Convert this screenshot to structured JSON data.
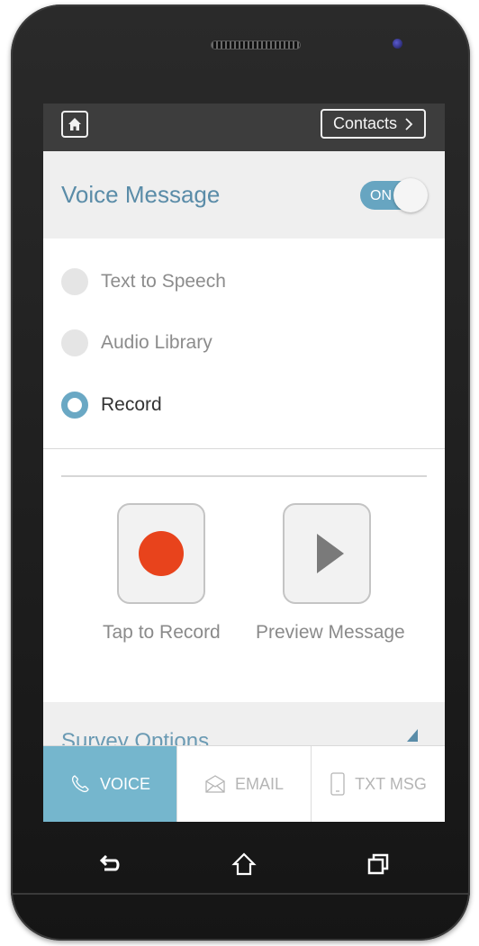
{
  "topbar": {
    "home_icon": "home-icon",
    "contacts_label": "Contacts",
    "contacts_chevron": "›"
  },
  "voice_message": {
    "title": "Voice Message",
    "toggle_label": "ON",
    "toggle_on": true
  },
  "options": {
    "items": [
      {
        "label": "Text to Speech",
        "selected": false
      },
      {
        "label": "Audio Library",
        "selected": false
      },
      {
        "label": "Record",
        "selected": true
      }
    ]
  },
  "record": {
    "record_caption": "Tap to Record",
    "preview_caption": "Preview Message"
  },
  "survey": {
    "title": "Survey Options"
  },
  "tabs": [
    {
      "label": "VOICE",
      "icon": "phone-icon",
      "active": true
    },
    {
      "label": "EMAIL",
      "icon": "envelope-icon",
      "active": false
    },
    {
      "label": "TXT MSG",
      "icon": "mobile-icon",
      "active": false
    }
  ],
  "navbar": {
    "back_icon": "back-icon",
    "home_icon": "home-outline-icon",
    "recent_icon": "recent-apps-icon"
  },
  "colors": {
    "accent": "#67a5c1",
    "tab_active": "#75b6cd",
    "record": "#e8431c",
    "title": "#5a8ca8"
  }
}
